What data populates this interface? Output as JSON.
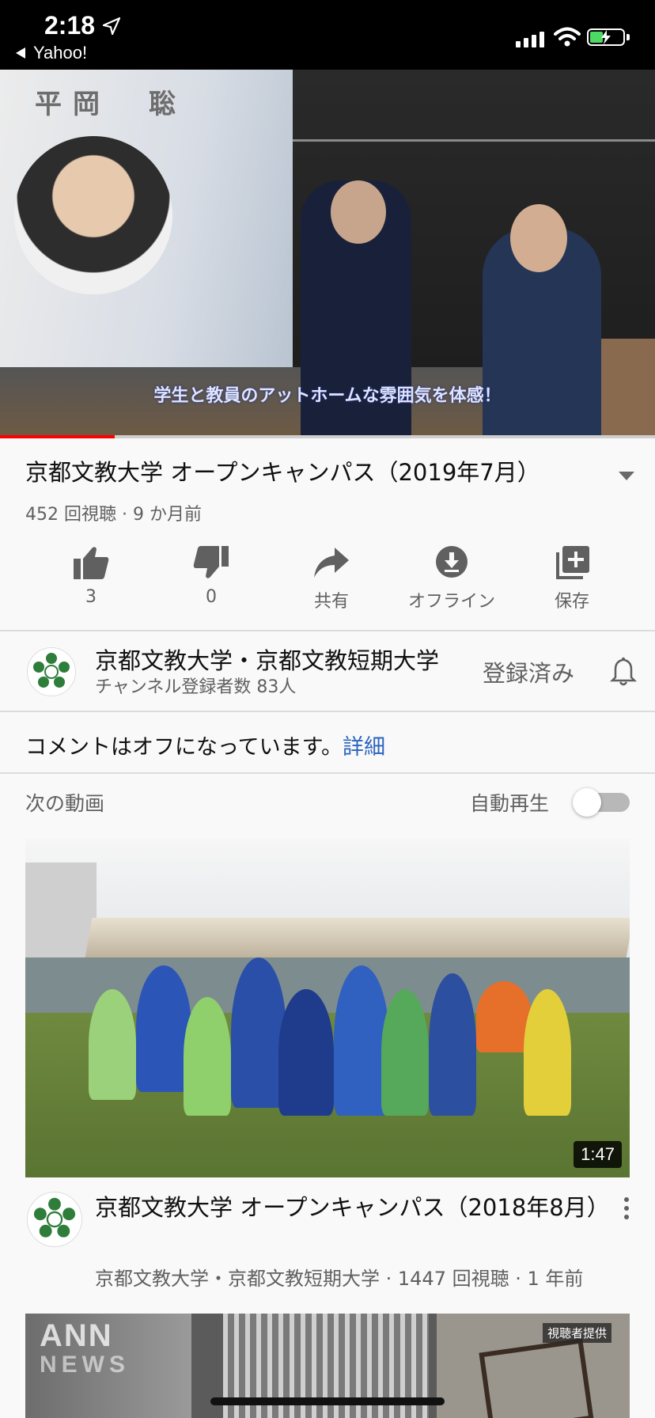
{
  "status_bar": {
    "time": "2:18",
    "back_app": "Yahoo!"
  },
  "player": {
    "screen_name": "平岡　聡",
    "subtitle": "学生と教員のアットホームな雰囲気を体感！",
    "progress_fraction": 0.175
  },
  "video": {
    "title": "京都文教大学 オープンキャンパス（2019年7月）",
    "meta": "452 回視聴 · 9 か月前"
  },
  "actions": [
    {
      "icon": "thumb-up-icon",
      "label": "3"
    },
    {
      "icon": "thumb-down-icon",
      "label": "0"
    },
    {
      "icon": "share-icon",
      "label": "共有"
    },
    {
      "icon": "download-icon",
      "label": "オフライン"
    },
    {
      "icon": "playlist-add-icon",
      "label": "保存"
    }
  ],
  "channel": {
    "name": "京都文教大学・京都文教短期大学",
    "subscribers": "チャンネル登録者数 83人",
    "subscribe_state": "登録済み"
  },
  "comments": {
    "text": "コメントはオフになっています。",
    "link": "詳細"
  },
  "up_next": {
    "label": "次の動画",
    "autoplay_label": "自動再生",
    "autoplay_on": false
  },
  "recommendations": [
    {
      "title": "京都文教大学 オープンキャンパス（2018年8月）",
      "meta": "京都文教大学・京都文教短期大学 · 1447 回視聴 · 1 年前",
      "duration": "1:47"
    },
    {
      "watermark_1": "ANN",
      "watermark_2": "NEWS",
      "badge": "視聴者提供"
    }
  ],
  "colors": {
    "progress": "#ff0000",
    "link": "#2a63c0",
    "battery": "#4cd964"
  }
}
